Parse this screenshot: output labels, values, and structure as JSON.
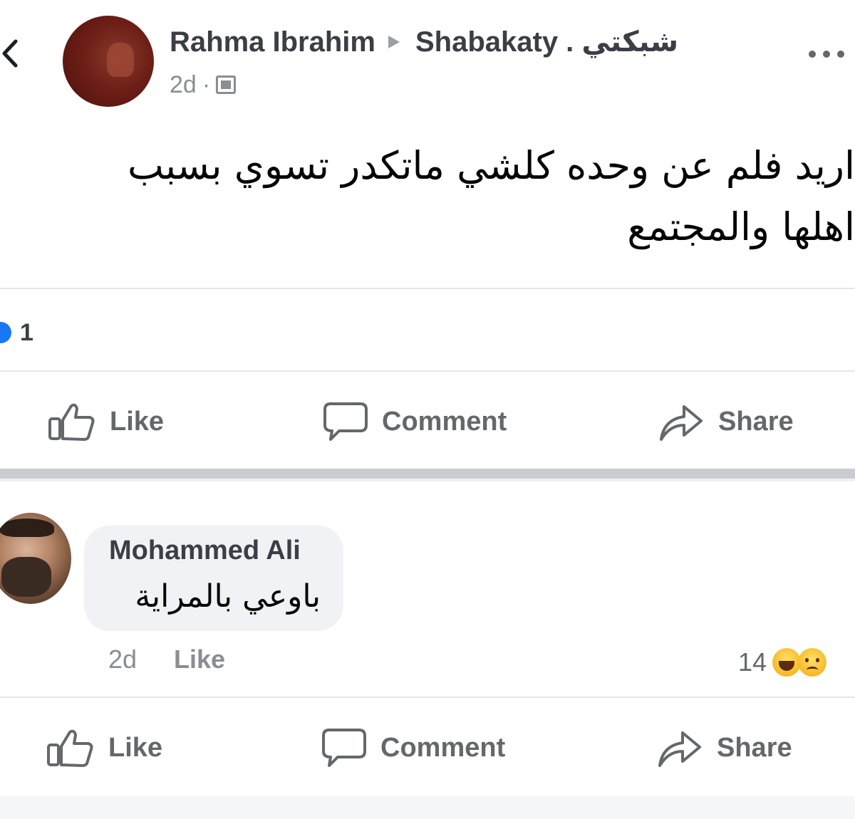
{
  "post": {
    "author": "Rahma Ibrahim",
    "group": "Shabakaty . شبكتي",
    "time": "2d",
    "dot": "·",
    "text": "اريد فلم عن وحده كلشي ماتكدر تسوي بسبب\nاهلها والمجتمع",
    "reaction_count": "1"
  },
  "actions": {
    "like": "Like",
    "comment": "Comment",
    "share": "Share"
  },
  "comment": {
    "author": "Mohammed Ali",
    "text": "باوعي بالمراية",
    "time": "2d",
    "like_label": "Like",
    "reaction_count": "14"
  },
  "icons": {
    "back": "chevron-left-icon",
    "more": "more-dots-icon",
    "privacy": "group-icon",
    "like": "thumbs-up-icon",
    "comment": "speech-bubble-icon",
    "share": "share-arrow-icon",
    "reactions": [
      "haha-icon",
      "sad-icon"
    ]
  },
  "colors": {
    "accent": "#1877f2",
    "text_secondary": "#65676b",
    "bubble": "#f0f2f5"
  }
}
